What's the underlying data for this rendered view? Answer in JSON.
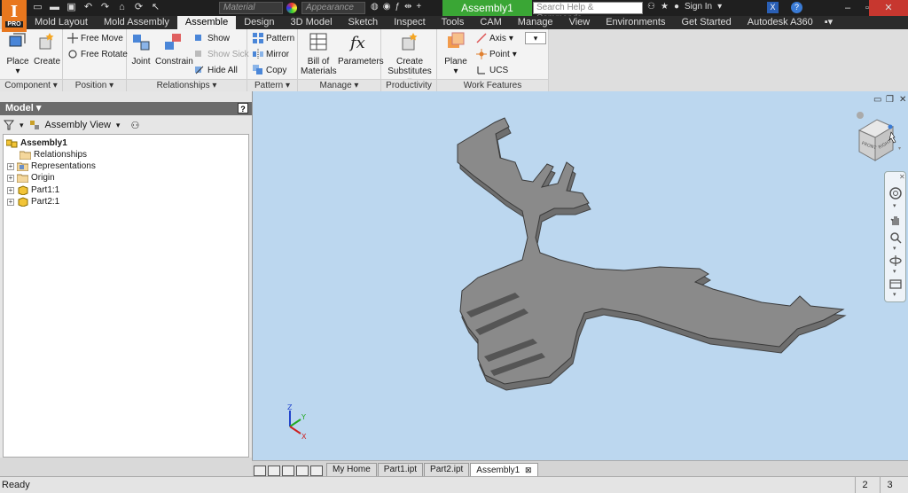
{
  "app": {
    "logo_letter": "I",
    "logo_badge": "PRO",
    "document_title": "Assembly1"
  },
  "titlebar": {
    "material_placeholder": "Material",
    "appearance_placeholder": "Appearance",
    "search_placeholder": "Search Help & Commands...",
    "sign_in": "Sign In"
  },
  "menu": {
    "tabs": [
      "Mold Layout",
      "Mold Assembly",
      "Assemble",
      "Design",
      "3D Model",
      "Sketch",
      "Inspect",
      "Tools",
      "CAM",
      "Manage",
      "View",
      "Environments",
      "Get Started",
      "Autodesk A360"
    ],
    "active": "Assemble"
  },
  "ribbon": {
    "component": {
      "label": "Component",
      "place": "Place",
      "create": "Create"
    },
    "position": {
      "label": "Position",
      "free_move": "Free Move",
      "free_rotate": "Free Rotate"
    },
    "relationships": {
      "label": "Relationships",
      "joint": "Joint",
      "constrain": "Constrain",
      "show": "Show",
      "show_sick": "Show Sick",
      "hide_all": "Hide All"
    },
    "pattern": {
      "label": "Pattern",
      "pattern": "Pattern",
      "mirror": "Mirror",
      "copy": "Copy"
    },
    "manage": {
      "label": "Manage",
      "bill_line1": "Bill of",
      "bill_line2": "Materials",
      "parameters": "Parameters"
    },
    "productivity": {
      "label": "Productivity",
      "create_line1": "Create",
      "create_line2": "Substitutes"
    },
    "work_features": {
      "label": "Work Features",
      "plane": "Plane",
      "axis": "Axis",
      "point": "Point",
      "ucs": "UCS"
    }
  },
  "browser": {
    "header": "Model",
    "view_label": "Assembly View",
    "tree": [
      {
        "label": "Assembly1",
        "bold": true
      },
      {
        "label": "Relationships"
      },
      {
        "label": "Representations"
      },
      {
        "label": "Origin"
      },
      {
        "label": "Part1:1"
      },
      {
        "label": "Part2:1"
      }
    ]
  },
  "viewcube": {
    "faces": [
      "FRONT",
      "RIGHT"
    ]
  },
  "triad": {
    "x": "X",
    "y": "Y",
    "z": "Z"
  },
  "doc_tabs": [
    "My Home",
    "Part1.ipt",
    "Part2.ipt",
    "Assembly1"
  ],
  "doc_tab_close": "⊠",
  "status": {
    "text": "Ready",
    "num1": "2",
    "num2": "3"
  },
  "colors": {
    "title_green": "#3aa635",
    "viewport_bg": "#bcd7ef",
    "part_gray": "#8a8a8a",
    "accent_orange": "#e8771e"
  }
}
